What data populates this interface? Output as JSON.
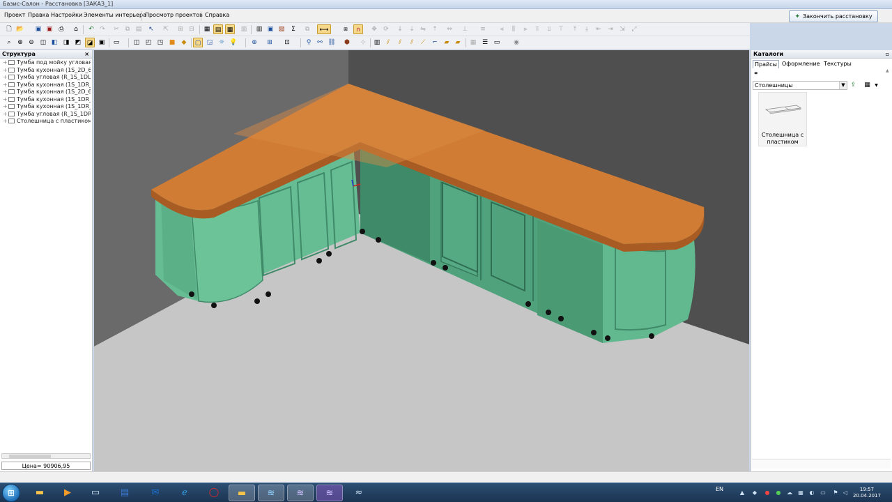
{
  "window": {
    "title": "Базис-Салон - Расстановка [ЗАКАЗ_1]"
  },
  "menu": {
    "items": [
      "Проект",
      "Правка",
      "Настройки",
      "Элементы интерьера",
      "Просмотр проектов",
      "Справка"
    ],
    "finish_button": "Закончить расстановку"
  },
  "structure": {
    "title": "Структура",
    "items": [
      "Тумба под мойку угловая (",
      "Тумба кухонная (1S_2D_6(",
      "Тумба угловая (R_1S_1DL)",
      "Тумба кухонная (1S_1DR_",
      "Тумба кухонная (1S_2D_6(",
      "Тумба кухонная (1S_1DR_",
      "Тумба кухонная (1S_1DR_",
      "Тумба угловая (R_1S_1DR)",
      "Столешница с пластиком"
    ],
    "price": "Цена= 90906,95"
  },
  "catalogs": {
    "title": "Каталоги",
    "tabs": [
      "Прайсы",
      "Оформление",
      "Текстуры"
    ],
    "active_tab": "Прайсы",
    "selected_category": "Столешницы",
    "item_caption": "Столешница с пластиком"
  },
  "colors": {
    "wall_light": "#6a6a6a",
    "wall_dark": "#4f4f4f",
    "floor": "#c6c6c6",
    "countertop": "#d07c34",
    "cabinet": "#5fb58d",
    "accent": "#f6d88a"
  },
  "taskbar": {
    "language": "EN",
    "time": "19:57",
    "date": "20.04.2017"
  }
}
